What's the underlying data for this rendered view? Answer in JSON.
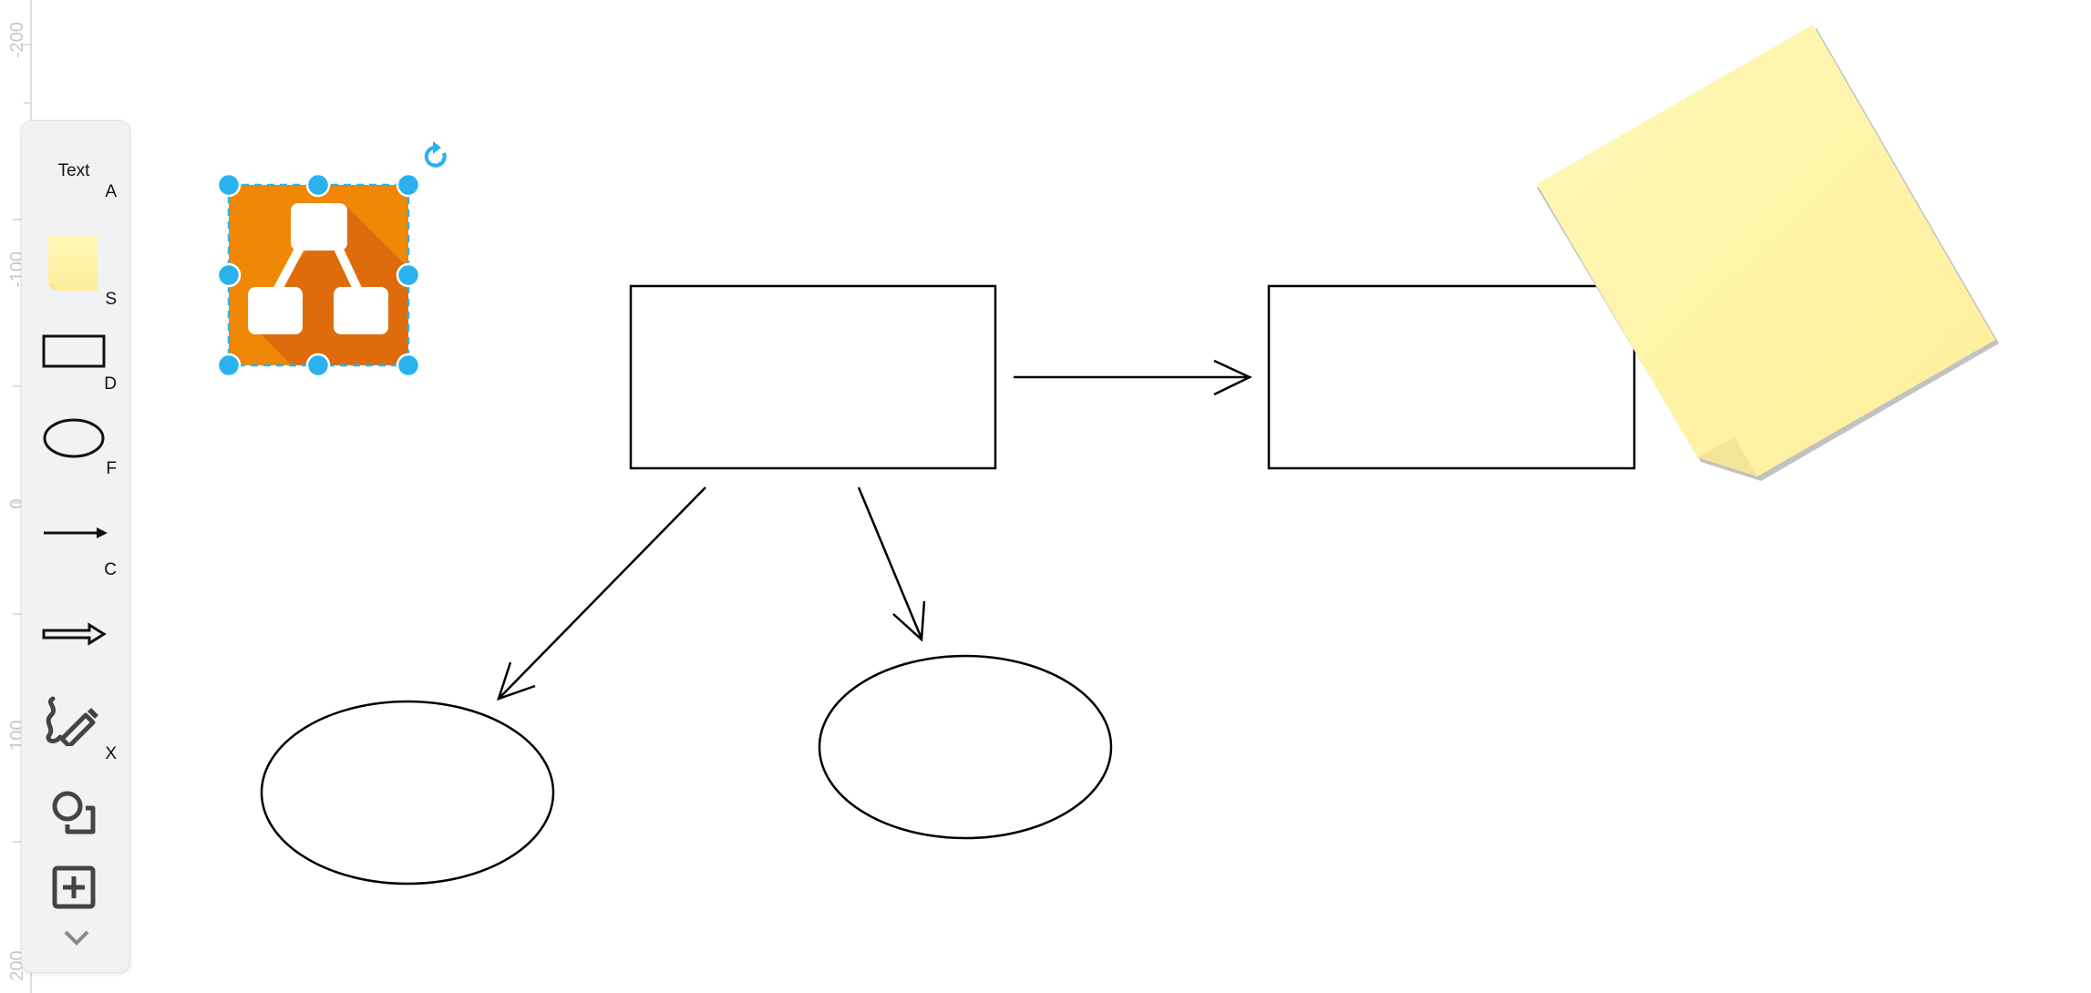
{
  "app": {
    "type": "diagram-editor-canvas"
  },
  "ruler": {
    "labels": [
      "-200",
      "-100",
      "0",
      "100",
      "200"
    ]
  },
  "toolbar": {
    "items": [
      {
        "name": "text",
        "label": "Text",
        "shortcut": "A",
        "icon": "text-icon"
      },
      {
        "name": "note",
        "label": "",
        "shortcut": "S",
        "icon": "sticky-note-icon"
      },
      {
        "name": "rectangle",
        "label": "",
        "shortcut": "D",
        "icon": "rectangle-icon"
      },
      {
        "name": "ellipse",
        "label": "",
        "shortcut": "F",
        "icon": "ellipse-icon"
      },
      {
        "name": "line",
        "label": "",
        "shortcut": "C",
        "icon": "line-arrow-icon"
      },
      {
        "name": "connector",
        "label": "",
        "shortcut": "",
        "icon": "block-arrow-icon"
      },
      {
        "name": "freehand",
        "label": "",
        "shortcut": "X",
        "icon": "freehand-pencil-icon"
      },
      {
        "name": "shapes",
        "label": "",
        "shortcut": "",
        "icon": "shapes-icon"
      },
      {
        "name": "insert",
        "label": "",
        "shortcut": "",
        "icon": "plus-square-icon"
      },
      {
        "name": "more",
        "label": "",
        "shortcut": "",
        "icon": "chevron-down-icon"
      }
    ]
  },
  "diagram": {
    "colors": {
      "selection": "#29b2ee",
      "icon_orange": "#f08705",
      "icon_orange_shadow": "#df6c0c",
      "sticky_yellow": "#fff5b0",
      "stroke": "#000000"
    },
    "selected_shape": {
      "name": "drawio-logo-image",
      "selected": true
    },
    "shapes": [
      {
        "id": "rect-1",
        "type": "rectangle",
        "text": ""
      },
      {
        "id": "rect-2",
        "type": "rectangle",
        "text": ""
      },
      {
        "id": "ellipse-1",
        "type": "ellipse",
        "text": ""
      },
      {
        "id": "ellipse-2",
        "type": "ellipse",
        "text": ""
      },
      {
        "id": "sticky-note",
        "type": "note",
        "text": ""
      }
    ],
    "connectors": [
      {
        "from": "rect-1",
        "to": "rect-2",
        "style": "open-arrow"
      },
      {
        "from": "rect-1",
        "to": "ellipse-1",
        "style": "open-arrow"
      },
      {
        "from": "rect-1",
        "to": "ellipse-2",
        "style": "open-arrow"
      }
    ]
  }
}
